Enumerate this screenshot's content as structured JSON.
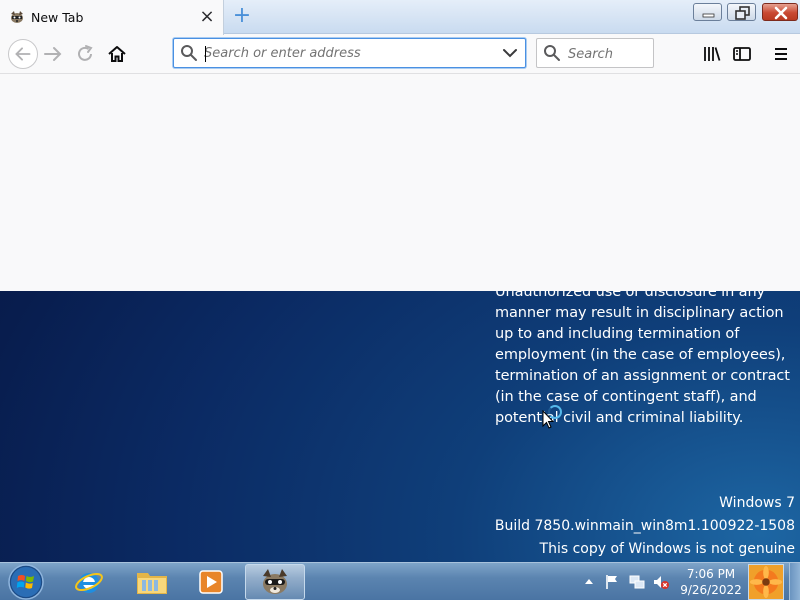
{
  "browser": {
    "tab": {
      "title": "New Tab",
      "close_label": "×"
    },
    "new_tab_label": "+",
    "urlbar": {
      "placeholder": "Search or enter address",
      "value": ""
    },
    "searchbar": {
      "placeholder": "Search",
      "value": ""
    }
  },
  "desktop": {
    "legal_text": "Unauthorized use or disclosure in any manner may result in disciplinary action up to and including termination of employment (in the case of employees), termination of an assignment or contract (in the case of contingent staff), and potential civil and criminal liability.",
    "windows_name": "Windows 7",
    "build": "Build 7850.winmain_win8m1.100922-1508",
    "genuine_notice": "This copy of Windows is not genuine"
  },
  "taskbar": {
    "items": [
      "start-orb-icon",
      "internet-explorer-icon",
      "windows-explorer-icon",
      "media-player-icon",
      "firefox-icon"
    ],
    "clock": {
      "time": "7:06 PM",
      "date": "9/26/2022"
    }
  },
  "colors": {
    "accent": "#4a90e2",
    "taskbar": "#5b84b0",
    "desktop": "#0b2150",
    "close_button": "#c94a33"
  }
}
